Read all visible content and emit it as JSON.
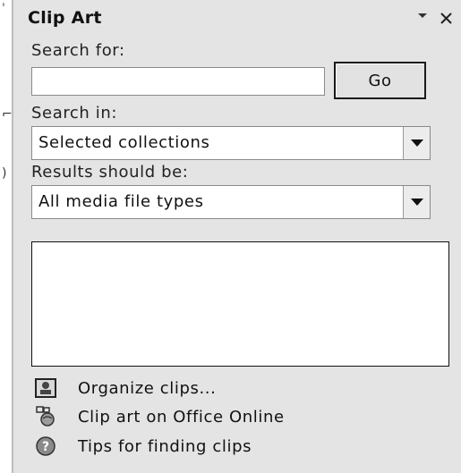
{
  "pane": {
    "title": "Clip Art",
    "dropdown_icon": "triangle-down-icon",
    "close_icon": "close-icon"
  },
  "search": {
    "label": "Search for:",
    "value": "",
    "placeholder": "",
    "go_label": "Go"
  },
  "search_in": {
    "label": "Search in:",
    "selected": "Selected collections"
  },
  "results_type": {
    "label": "Results should be:",
    "selected": "All media file types"
  },
  "links": [
    {
      "label": "Organize clips...",
      "icon": "organize-clips-icon"
    },
    {
      "label": "Clip art on Office Online",
      "icon": "office-online-icon"
    },
    {
      "label": "Tips for finding clips",
      "icon": "help-icon"
    }
  ]
}
